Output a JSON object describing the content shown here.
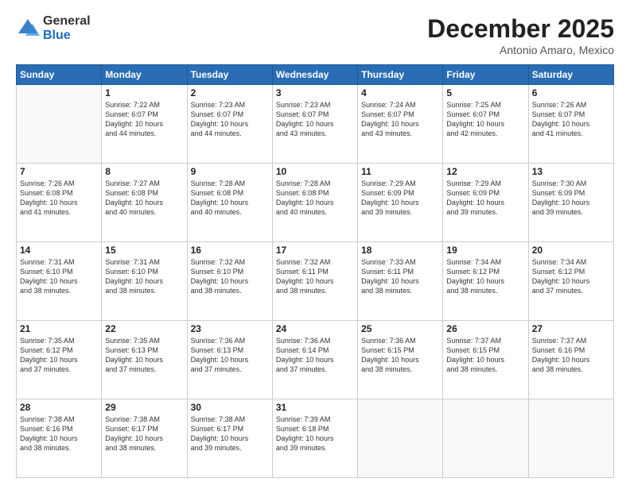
{
  "header": {
    "logo_general": "General",
    "logo_blue": "Blue",
    "month_title": "December 2025",
    "subtitle": "Antonio Amaro, Mexico"
  },
  "weekdays": [
    "Sunday",
    "Monday",
    "Tuesday",
    "Wednesday",
    "Thursday",
    "Friday",
    "Saturday"
  ],
  "weeks": [
    [
      {
        "day": "",
        "info": ""
      },
      {
        "day": "1",
        "info": "Sunrise: 7:22 AM\nSunset: 6:07 PM\nDaylight: 10 hours\nand 44 minutes."
      },
      {
        "day": "2",
        "info": "Sunrise: 7:23 AM\nSunset: 6:07 PM\nDaylight: 10 hours\nand 44 minutes."
      },
      {
        "day": "3",
        "info": "Sunrise: 7:23 AM\nSunset: 6:07 PM\nDaylight: 10 hours\nand 43 minutes."
      },
      {
        "day": "4",
        "info": "Sunrise: 7:24 AM\nSunset: 6:07 PM\nDaylight: 10 hours\nand 43 minutes."
      },
      {
        "day": "5",
        "info": "Sunrise: 7:25 AM\nSunset: 6:07 PM\nDaylight: 10 hours\nand 42 minutes."
      },
      {
        "day": "6",
        "info": "Sunrise: 7:26 AM\nSunset: 6:07 PM\nDaylight: 10 hours\nand 41 minutes."
      }
    ],
    [
      {
        "day": "7",
        "info": "Sunrise: 7:26 AM\nSunset: 6:08 PM\nDaylight: 10 hours\nand 41 minutes."
      },
      {
        "day": "8",
        "info": "Sunrise: 7:27 AM\nSunset: 6:08 PM\nDaylight: 10 hours\nand 40 minutes."
      },
      {
        "day": "9",
        "info": "Sunrise: 7:28 AM\nSunset: 6:08 PM\nDaylight: 10 hours\nand 40 minutes."
      },
      {
        "day": "10",
        "info": "Sunrise: 7:28 AM\nSunset: 6:08 PM\nDaylight: 10 hours\nand 40 minutes."
      },
      {
        "day": "11",
        "info": "Sunrise: 7:29 AM\nSunset: 6:09 PM\nDaylight: 10 hours\nand 39 minutes."
      },
      {
        "day": "12",
        "info": "Sunrise: 7:29 AM\nSunset: 6:09 PM\nDaylight: 10 hours\nand 39 minutes."
      },
      {
        "day": "13",
        "info": "Sunrise: 7:30 AM\nSunset: 6:09 PM\nDaylight: 10 hours\nand 39 minutes."
      }
    ],
    [
      {
        "day": "14",
        "info": "Sunrise: 7:31 AM\nSunset: 6:10 PM\nDaylight: 10 hours\nand 38 minutes."
      },
      {
        "day": "15",
        "info": "Sunrise: 7:31 AM\nSunset: 6:10 PM\nDaylight: 10 hours\nand 38 minutes."
      },
      {
        "day": "16",
        "info": "Sunrise: 7:32 AM\nSunset: 6:10 PM\nDaylight: 10 hours\nand 38 minutes."
      },
      {
        "day": "17",
        "info": "Sunrise: 7:32 AM\nSunset: 6:11 PM\nDaylight: 10 hours\nand 38 minutes."
      },
      {
        "day": "18",
        "info": "Sunrise: 7:33 AM\nSunset: 6:11 PM\nDaylight: 10 hours\nand 38 minutes."
      },
      {
        "day": "19",
        "info": "Sunrise: 7:34 AM\nSunset: 6:12 PM\nDaylight: 10 hours\nand 38 minutes."
      },
      {
        "day": "20",
        "info": "Sunrise: 7:34 AM\nSunset: 6:12 PM\nDaylight: 10 hours\nand 37 minutes."
      }
    ],
    [
      {
        "day": "21",
        "info": "Sunrise: 7:35 AM\nSunset: 6:12 PM\nDaylight: 10 hours\nand 37 minutes."
      },
      {
        "day": "22",
        "info": "Sunrise: 7:35 AM\nSunset: 6:13 PM\nDaylight: 10 hours\nand 37 minutes."
      },
      {
        "day": "23",
        "info": "Sunrise: 7:36 AM\nSunset: 6:13 PM\nDaylight: 10 hours\nand 37 minutes."
      },
      {
        "day": "24",
        "info": "Sunrise: 7:36 AM\nSunset: 6:14 PM\nDaylight: 10 hours\nand 37 minutes."
      },
      {
        "day": "25",
        "info": "Sunrise: 7:36 AM\nSunset: 6:15 PM\nDaylight: 10 hours\nand 38 minutes."
      },
      {
        "day": "26",
        "info": "Sunrise: 7:37 AM\nSunset: 6:15 PM\nDaylight: 10 hours\nand 38 minutes."
      },
      {
        "day": "27",
        "info": "Sunrise: 7:37 AM\nSunset: 6:16 PM\nDaylight: 10 hours\nand 38 minutes."
      }
    ],
    [
      {
        "day": "28",
        "info": "Sunrise: 7:38 AM\nSunset: 6:16 PM\nDaylight: 10 hours\nand 38 minutes."
      },
      {
        "day": "29",
        "info": "Sunrise: 7:38 AM\nSunset: 6:17 PM\nDaylight: 10 hours\nand 38 minutes."
      },
      {
        "day": "30",
        "info": "Sunrise: 7:38 AM\nSunset: 6:17 PM\nDaylight: 10 hours\nand 39 minutes."
      },
      {
        "day": "31",
        "info": "Sunrise: 7:39 AM\nSunset: 6:18 PM\nDaylight: 10 hours\nand 39 minutes."
      },
      {
        "day": "",
        "info": ""
      },
      {
        "day": "",
        "info": ""
      },
      {
        "day": "",
        "info": ""
      }
    ]
  ]
}
